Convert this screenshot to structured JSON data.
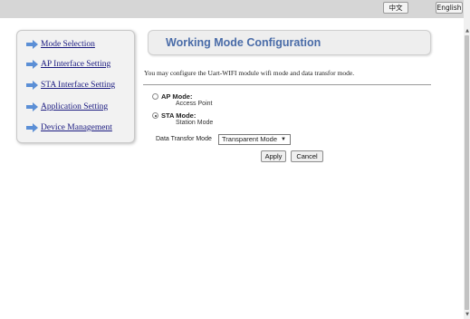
{
  "header": {
    "lang_chinese": "中文",
    "lang_english": "English"
  },
  "sidebar": {
    "items": [
      {
        "label": "Mode Selection"
      },
      {
        "label": "AP Interface Setting"
      },
      {
        "label": "STA Interface Setting"
      },
      {
        "label": "Application Setting"
      },
      {
        "label": "Device Management"
      }
    ]
  },
  "main": {
    "title": "Working Mode Configuration",
    "description": "You may configure the Uart-WIFI module wifi mode and data transfor mode.",
    "modes": [
      {
        "label": "AP Mode:",
        "sublabel": "Access Point",
        "selected": false
      },
      {
        "label": "STA Mode:",
        "sublabel": "Station Mode",
        "selected": true
      }
    ],
    "data_transfer": {
      "label": "Data Transfor Mode",
      "selected": "Transparent Mode"
    },
    "buttons": {
      "apply": "Apply",
      "cancel": "Cancel"
    }
  },
  "colors": {
    "title_text": "#4a6ca8",
    "nav_link": "#1a1a80",
    "nav_arrow": "#5b8fd6"
  }
}
